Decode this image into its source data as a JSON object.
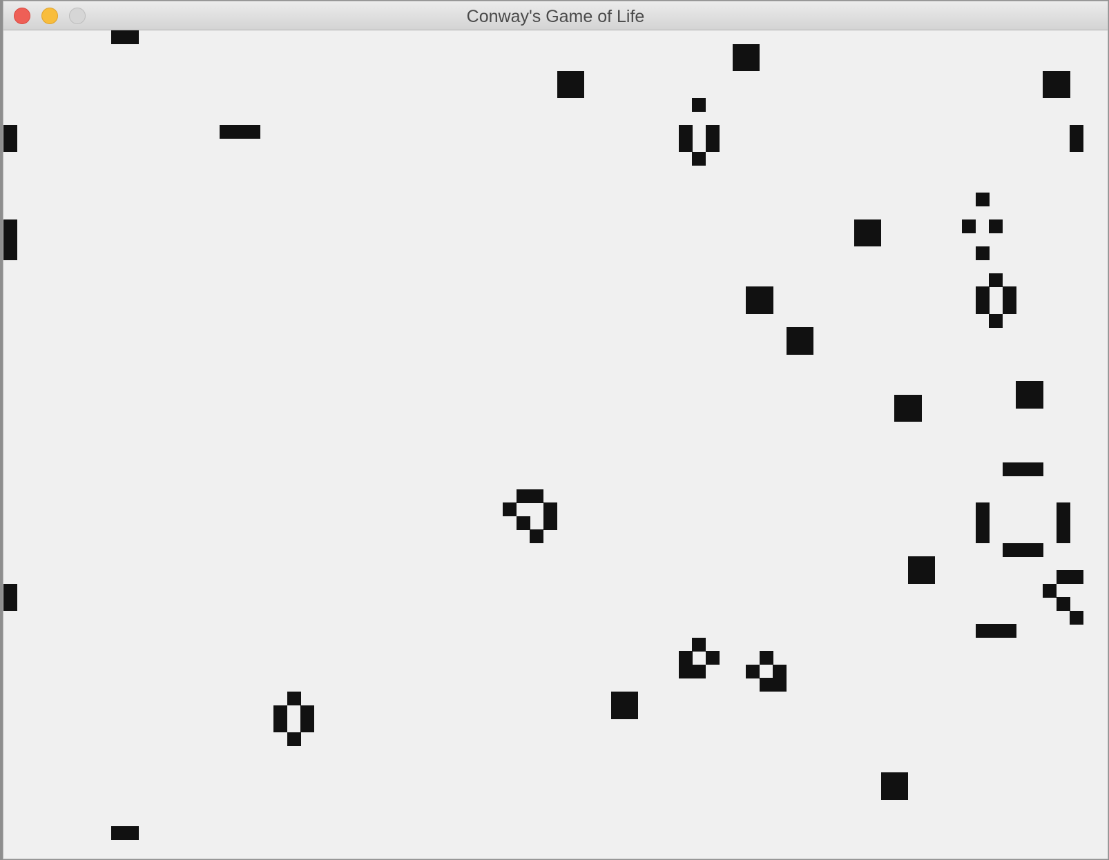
{
  "window": {
    "title": "Conway's Game of Life"
  },
  "colors": {
    "alive": "#111111",
    "dead": "#f0f0f0",
    "close": "#ee5f56",
    "minimize": "#f8bd3c",
    "zoom": "#d6d6d6"
  },
  "icons": [
    "close-icon",
    "minimize-icon",
    "zoom-icon"
  ],
  "grid": {
    "alive_cells": [
      [
        8,
        0
      ],
      [
        9,
        0
      ],
      [
        54,
        1
      ],
      [
        55,
        1
      ],
      [
        54,
        2
      ],
      [
        55,
        2
      ],
      [
        41,
        3
      ],
      [
        42,
        3
      ],
      [
        41,
        4
      ],
      [
        42,
        4
      ],
      [
        77,
        3
      ],
      [
        78,
        3
      ],
      [
        77,
        4
      ],
      [
        78,
        4
      ],
      [
        51,
        5
      ],
      [
        0,
        7
      ],
      [
        50,
        7
      ],
      [
        52,
        7
      ],
      [
        79,
        7
      ],
      [
        0,
        8
      ],
      [
        50,
        8
      ],
      [
        52,
        8
      ],
      [
        79,
        8
      ],
      [
        16,
        7
      ],
      [
        17,
        7
      ],
      [
        18,
        7
      ],
      [
        51,
        9
      ],
      [
        72,
        12
      ],
      [
        0,
        14
      ],
      [
        63,
        14
      ],
      [
        64,
        14
      ],
      [
        71,
        14
      ],
      [
        73,
        14
      ],
      [
        0,
        15
      ],
      [
        63,
        15
      ],
      [
        64,
        15
      ],
      [
        0,
        16
      ],
      [
        72,
        16
      ],
      [
        73,
        18
      ],
      [
        55,
        19
      ],
      [
        56,
        19
      ],
      [
        72,
        19
      ],
      [
        74,
        19
      ],
      [
        55,
        20
      ],
      [
        56,
        20
      ],
      [
        72,
        20
      ],
      [
        74,
        20
      ],
      [
        73,
        21
      ],
      [
        58,
        22
      ],
      [
        59,
        22
      ],
      [
        58,
        23
      ],
      [
        59,
        23
      ],
      [
        75,
        26
      ],
      [
        76,
        26
      ],
      [
        75,
        27
      ],
      [
        76,
        27
      ],
      [
        66,
        27
      ],
      [
        67,
        27
      ],
      [
        66,
        28
      ],
      [
        67,
        28
      ],
      [
        74,
        32
      ],
      [
        75,
        32
      ],
      [
        76,
        32
      ],
      [
        38,
        34
      ],
      [
        39,
        34
      ],
      [
        37,
        35
      ],
      [
        40,
        35
      ],
      [
        72,
        35
      ],
      [
        78,
        35
      ],
      [
        38,
        36
      ],
      [
        40,
        36
      ],
      [
        72,
        36
      ],
      [
        78,
        36
      ],
      [
        39,
        37
      ],
      [
        72,
        37
      ],
      [
        78,
        37
      ],
      [
        74,
        38
      ],
      [
        75,
        38
      ],
      [
        76,
        38
      ],
      [
        67,
        39
      ],
      [
        68,
        39
      ],
      [
        67,
        40
      ],
      [
        68,
        40
      ],
      [
        78,
        40
      ],
      [
        79,
        40
      ],
      [
        0,
        41
      ],
      [
        77,
        41
      ],
      [
        0,
        42
      ],
      [
        78,
        42
      ],
      [
        79,
        43
      ],
      [
        72,
        44
      ],
      [
        73,
        44
      ],
      [
        74,
        44
      ],
      [
        51,
        45
      ],
      [
        50,
        46
      ],
      [
        52,
        46
      ],
      [
        56,
        46
      ],
      [
        50,
        47
      ],
      [
        51,
        47
      ],
      [
        55,
        47
      ],
      [
        57,
        47
      ],
      [
        56,
        48
      ],
      [
        57,
        48
      ],
      [
        21,
        49
      ],
      [
        45,
        49
      ],
      [
        46,
        49
      ],
      [
        20,
        50
      ],
      [
        22,
        50
      ],
      [
        45,
        50
      ],
      [
        46,
        50
      ],
      [
        20,
        51
      ],
      [
        22,
        51
      ],
      [
        21,
        52
      ],
      [
        65,
        55
      ],
      [
        66,
        55
      ],
      [
        65,
        56
      ],
      [
        66,
        56
      ],
      [
        8,
        59
      ],
      [
        9,
        59
      ]
    ]
  }
}
